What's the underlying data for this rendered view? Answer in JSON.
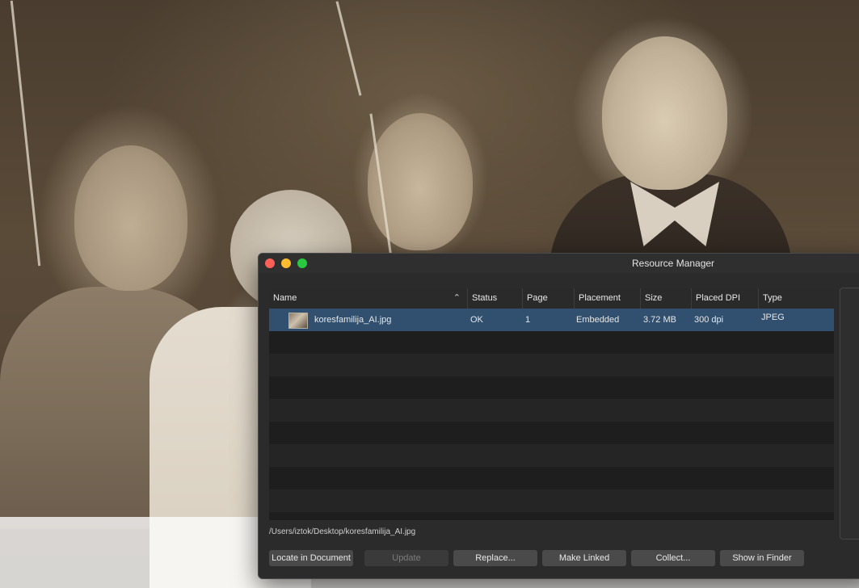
{
  "window": {
    "title": "Resource Manager"
  },
  "table": {
    "columns": [
      {
        "label": "Name"
      },
      {
        "label": "Status"
      },
      {
        "label": "Page"
      },
      {
        "label": "Placement"
      },
      {
        "label": "Size"
      },
      {
        "label": "Placed DPI"
      },
      {
        "label": "Type"
      }
    ],
    "sort_icon": "chevron-up-icon",
    "rows": [
      {
        "name": "koresfamilija_AI.jpg",
        "status": "OK",
        "page": "1",
        "placement": "Embedded",
        "size": "3.72 MB",
        "dpi": "300 dpi",
        "type": "JPEG"
      }
    ]
  },
  "path": "/Users/iztok/Desktop/koresfamilija_AI.jpg",
  "buttons": {
    "locate": "Locate in Document",
    "update": "Update",
    "replace": "Replace...",
    "make_linked": "Make Linked",
    "collect": "Collect...",
    "show_in_finder": "Show in Finder"
  },
  "colors": {
    "selection": "#31506f",
    "close": "#fe5f57",
    "minimize": "#febc2e",
    "maximize": "#28c840"
  }
}
